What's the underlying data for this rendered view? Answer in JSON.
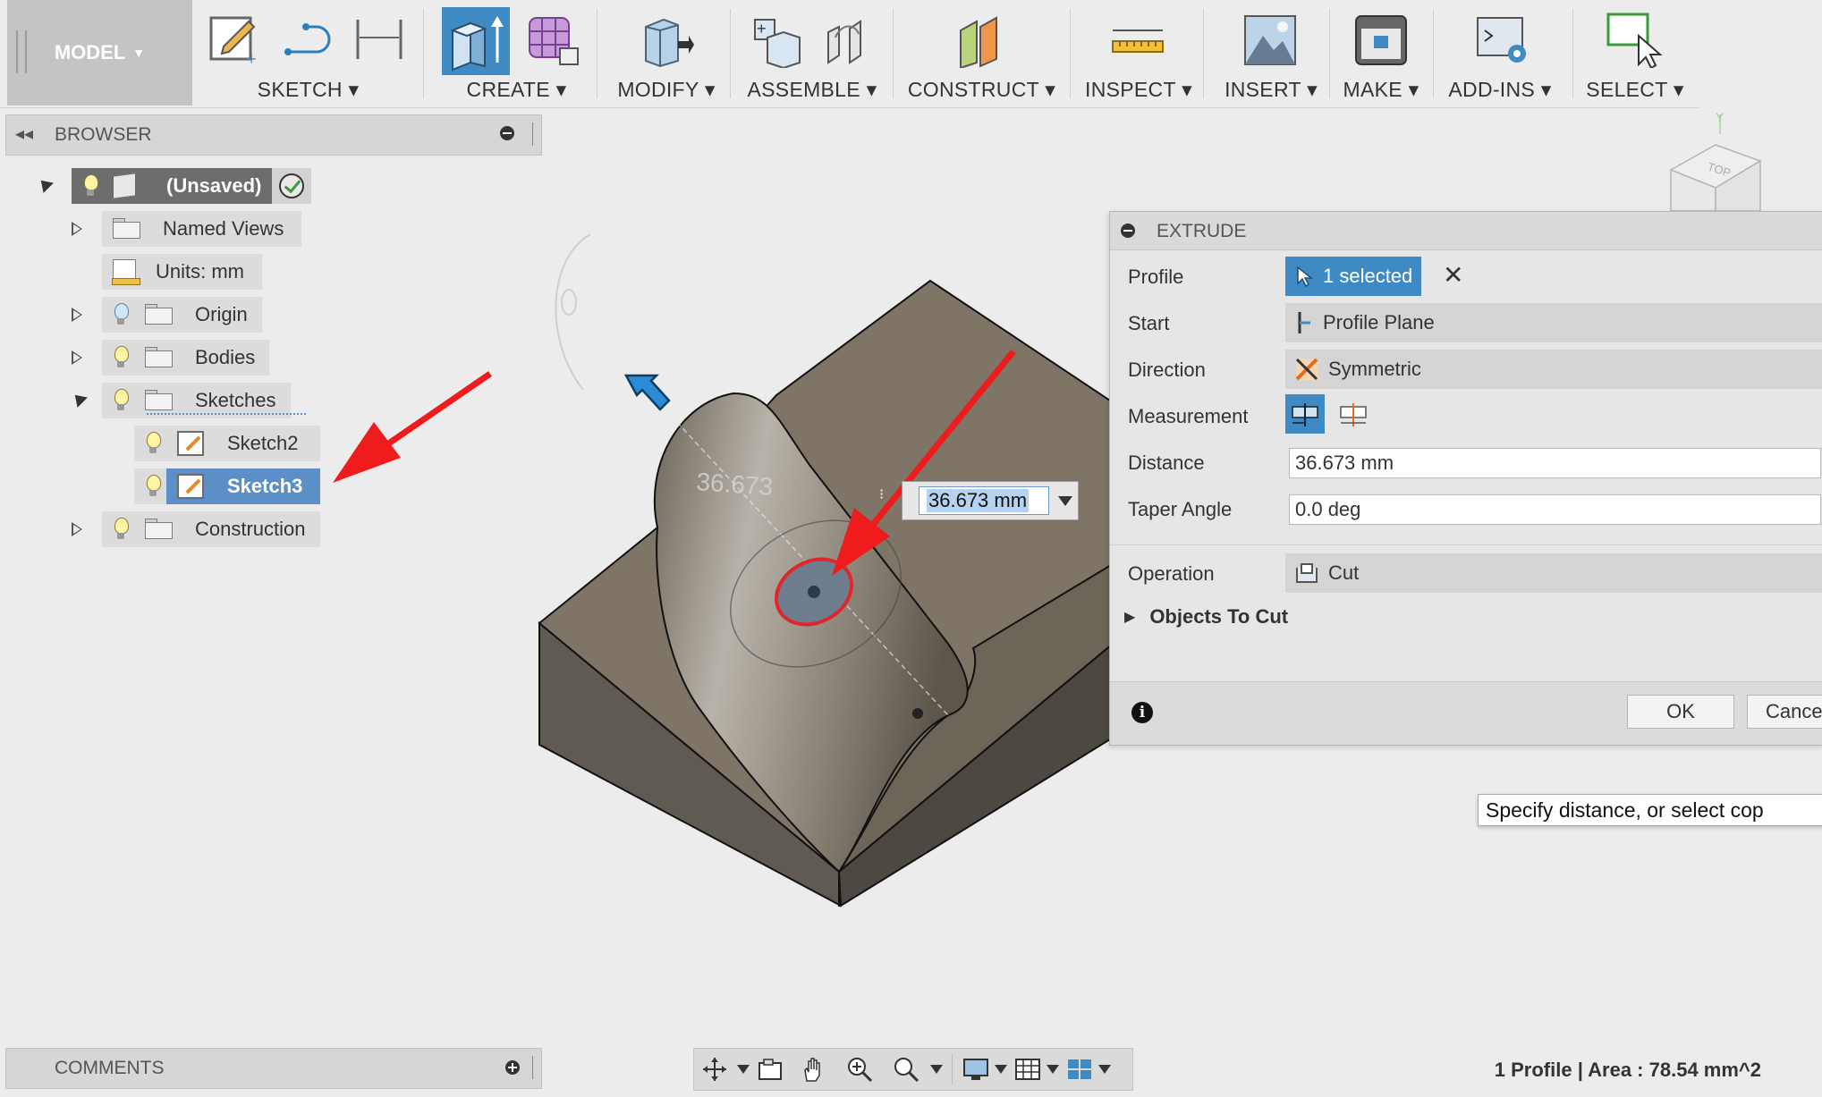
{
  "toolbar": {
    "workspace": "MODEL",
    "groups": [
      {
        "label": "SKETCH"
      },
      {
        "label": "CREATE"
      },
      {
        "label": "MODIFY"
      },
      {
        "label": "ASSEMBLE"
      },
      {
        "label": "CONSTRUCT"
      },
      {
        "label": "INSPECT"
      },
      {
        "label": "INSERT"
      },
      {
        "label": "MAKE"
      },
      {
        "label": "ADD-INS"
      },
      {
        "label": "SELECT"
      }
    ]
  },
  "browser": {
    "title": "BROWSER",
    "root": "(Unsaved)",
    "items": [
      {
        "label": "Named Views"
      },
      {
        "label": "Units: mm"
      },
      {
        "label": "Origin"
      },
      {
        "label": "Bodies"
      },
      {
        "label": "Sketches"
      },
      {
        "label": "Sketch2"
      },
      {
        "label": "Sketch3"
      },
      {
        "label": "Construction"
      }
    ]
  },
  "comments": {
    "title": "COMMENTS"
  },
  "viewport": {
    "dimension_ghost": "36.673",
    "dimension_input": "36.673 mm",
    "viewcube_label": "TOP",
    "axis_label": "Y"
  },
  "extrude": {
    "title": "EXTRUDE",
    "profile_label": "Profile",
    "profile_value": "1 selected",
    "start_label": "Start",
    "start_value": "Profile Plane",
    "direction_label": "Direction",
    "direction_value": "Symmetric",
    "measurement_label": "Measurement",
    "distance_label": "Distance",
    "distance_value": "36.673 mm",
    "taper_label": "Taper Angle",
    "taper_value": "0.0 deg",
    "operation_label": "Operation",
    "operation_value": "Cut",
    "objects_label": "Objects To Cut",
    "ok": "OK",
    "cancel": "Cance"
  },
  "tooltip": "Specify distance, or select cop",
  "status": "1 Profile | Area : 78.54 mm^2",
  "colors": {
    "accent": "#3f8ac2",
    "annotation": "#ee1c1c",
    "body": "#7e7567"
  }
}
